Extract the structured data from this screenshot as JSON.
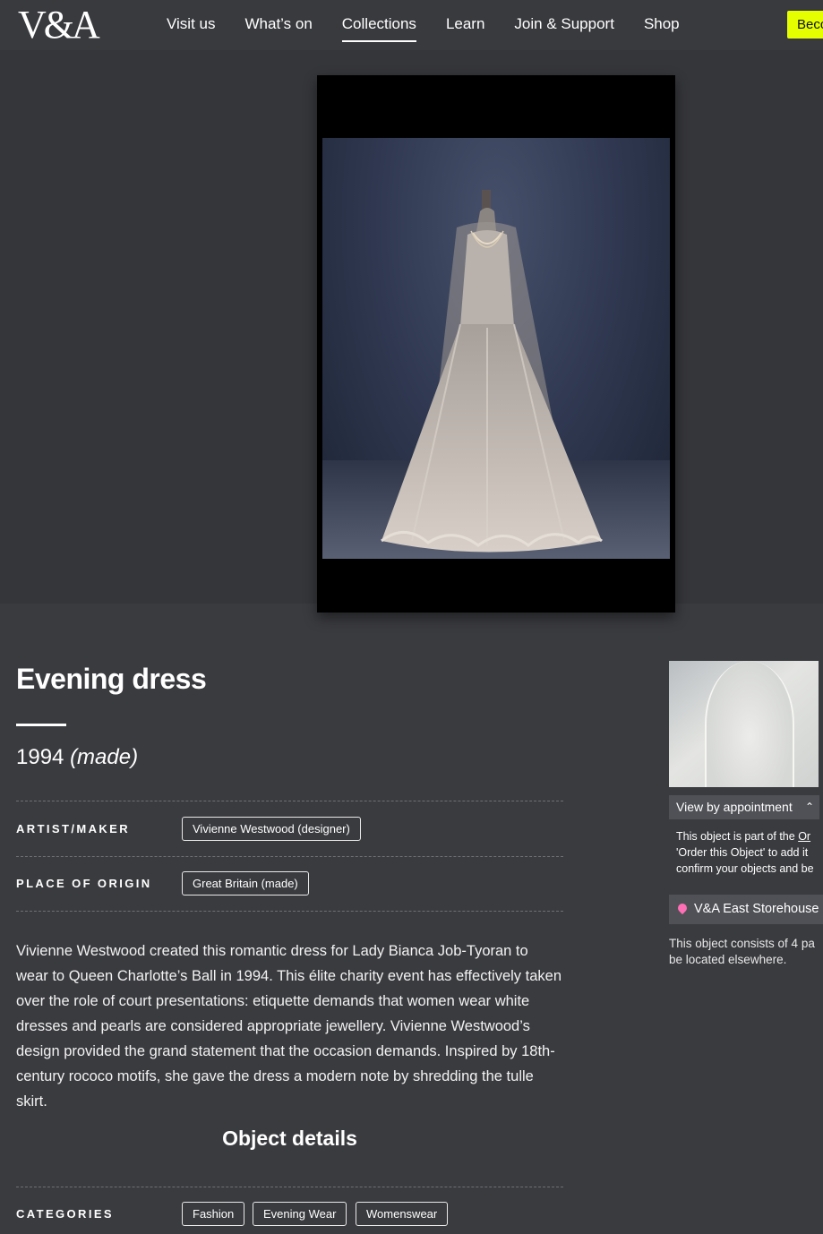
{
  "header": {
    "logo": "V&A",
    "nav": [
      "Visit us",
      "What’s on",
      "Collections",
      "Learn",
      "Join & Support",
      "Shop"
    ],
    "active_nav": "Collections",
    "cta_label": "Becc"
  },
  "object": {
    "title": "Evening dress",
    "date": "1994",
    "date_qualifier": "(made)",
    "artist_label": "ARTIST/MAKER",
    "artist_value": "Vivienne Westwood (designer)",
    "origin_label": "PLACE OF ORIGIN",
    "origin_value": "Great Britain (made)",
    "description": "Vivienne Westwood created this romantic dress for Lady Bianca Job-Tyoran to wear to Queen Charlotte’s Ball in 1994. This élite charity event has effectively taken over the role of court presentations: etiquette demands that women wear white dresses and pearls are considered appropriate jewellery. Vivienne Westwood’s design provided the grand statement that the occasion demands. Inspired by 18th-century rococo motifs, she gave the dress a modern note by shredding the tulle skirt.",
    "details_heading": "Object details",
    "categories_label": "CATEGORIES",
    "categories": [
      "Fashion",
      "Evening Wear",
      "Womenswear"
    ]
  },
  "sidebar": {
    "appointment_label": "View by appointment",
    "appointment_line1": "This object is part of the ",
    "appointment_link": "Or",
    "appointment_line2": "'Order this Object' to add it",
    "appointment_line3": "confirm your objects and be",
    "store_label": "V&A East Storehouse",
    "consists_text": "This object consists of 4 pa be located elsewhere."
  },
  "colors": {
    "background": "#3a3b3f",
    "hero_background": "#35363a",
    "accent": "#e6ff00",
    "location_pin": "#ff6fb5"
  }
}
